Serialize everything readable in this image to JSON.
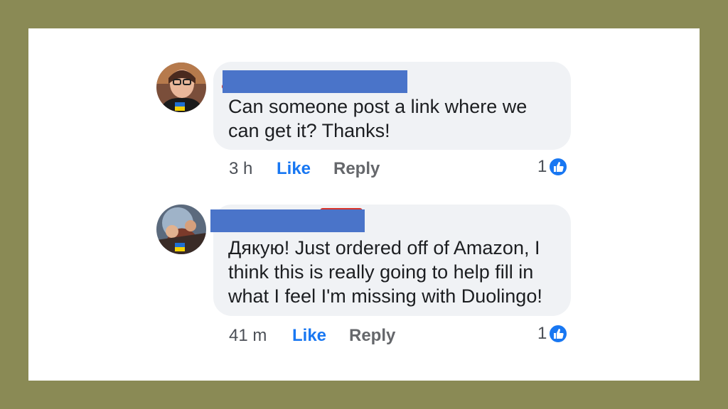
{
  "comments": [
    {
      "text": "Can someone post a link where we\ncan get it? Thanks!",
      "time": "3 h",
      "like_label": "Like",
      "reply_label": "Reply",
      "reaction_count": "1",
      "reaction_icon": "thumbs-up-icon"
    },
    {
      "text": "Дякую! Just ordered off of Amazon, I\nthink this is really going to help fill in\nwhat I feel I'm missing with Duolingo!",
      "time": "41 m",
      "like_label": "Like",
      "reply_label": "Reply",
      "reaction_count": "1",
      "reaction_icon": "thumbs-up-icon"
    }
  ],
  "colors": {
    "frame": "#8a8a55",
    "bubble": "#f0f2f5",
    "redaction": "#4a74c9",
    "like_blue": "#1877f2"
  }
}
